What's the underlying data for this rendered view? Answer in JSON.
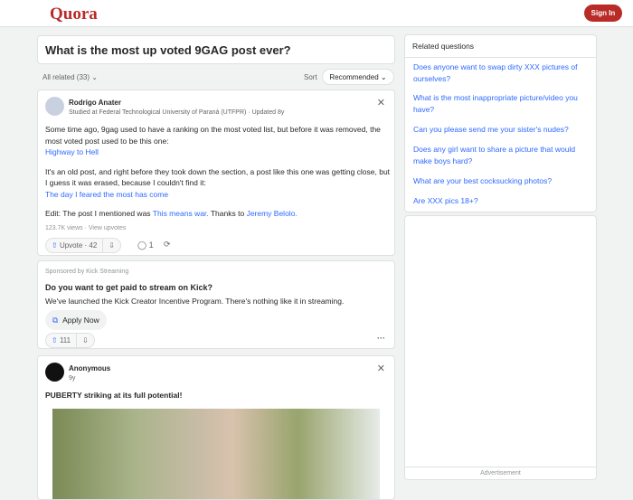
{
  "header": {
    "logo": "Quora",
    "signin": "Sign In"
  },
  "question": {
    "title": "What is the most up voted 9GAG post ever?",
    "filter": "All related (33)",
    "sort_label": "Sort",
    "sort_value": "Recommended"
  },
  "answer1": {
    "author": "Rodrigo Anater",
    "credential": "Studied at Federal Technological University of Paraná (UTFPR) · Updated 8y",
    "p1": "Some time ago, 9gag used to have a ranking on the most voted list, but before it was removed, the most voted post used to be this one:",
    "link1": "Highway to Hell",
    "p2": "It's an old post, and right before they took down the section, a post like this one was getting close, but I guess it was erased, because I couldn't find it:",
    "link2": "The day I feared the most has come",
    "p3a": "Edit: The post I mentioned was ",
    "link3": "This means war.",
    "p3b": " Thanks to ",
    "link4": "Jeremy Belolo.",
    "views": "123.7K views · View upvotes",
    "upvote": "Upvote · 42",
    "comments": "1"
  },
  "ad": {
    "sponsor": "Sponsored by Kick Streaming",
    "title": "Do you want to get paid to stream on Kick?",
    "text": "We've launched the Kick Creator Incentive Program. There's nothing like it in streaming.",
    "cta": "Apply Now",
    "upvotes": "111"
  },
  "answer2": {
    "author": "Anonymous",
    "time": "9y",
    "text": "PUBERTY striking at its full potential!"
  },
  "sidebar": {
    "title": "Related questions",
    "items": [
      "Does anyone want to swap dirty XXX pictures of ourselves?",
      "What is the most inappropriate picture/video you have?",
      "Can you please send me your sister's nudes?",
      "Does any girl want to share a picture that would make boys hard?",
      "What are your best cocksucking photos?",
      "Are XXX pics 18+?"
    ],
    "ad_label": "Advertisement"
  }
}
